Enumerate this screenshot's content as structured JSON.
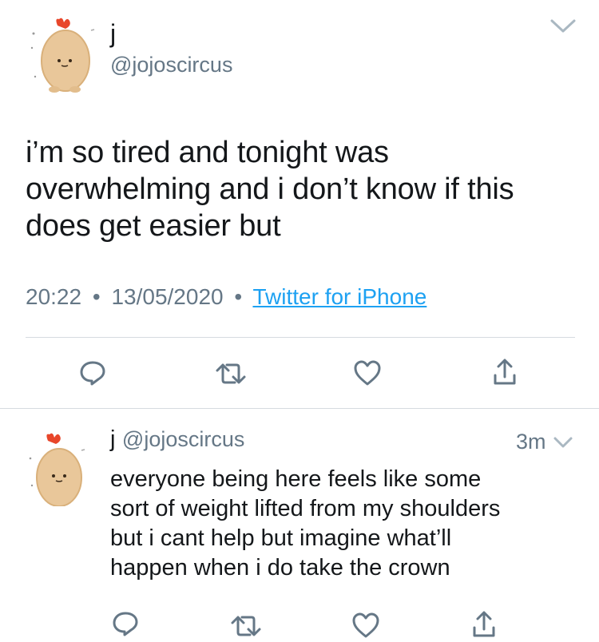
{
  "main_tweet": {
    "name": "j",
    "handle": "@jojoscircus",
    "text_lines": [
      "i’m so tired and tonight was",
      "overwhelming and i don’t know if this",
      "does get easier but"
    ],
    "time": "20:22",
    "sep": "•",
    "date": "13/05/2020",
    "source": "Twitter for iPhone"
  },
  "reply_tweet": {
    "name": "j",
    "handle": "@jojoscircus",
    "time_ago": "3m",
    "text_lines": [
      "everyone being here feels like some",
      "sort of weight lifted from my shoulders",
      "but i cant help but imagine what’ll",
      "happen when i do take the crown"
    ]
  },
  "colors": {
    "text": "#14171a",
    "muted": "#657786",
    "link": "#1da1f2",
    "divider": "#d6dbe0"
  },
  "icons": [
    "chevron-down-icon",
    "reply-icon",
    "retweet-icon",
    "like-icon",
    "share-icon"
  ]
}
